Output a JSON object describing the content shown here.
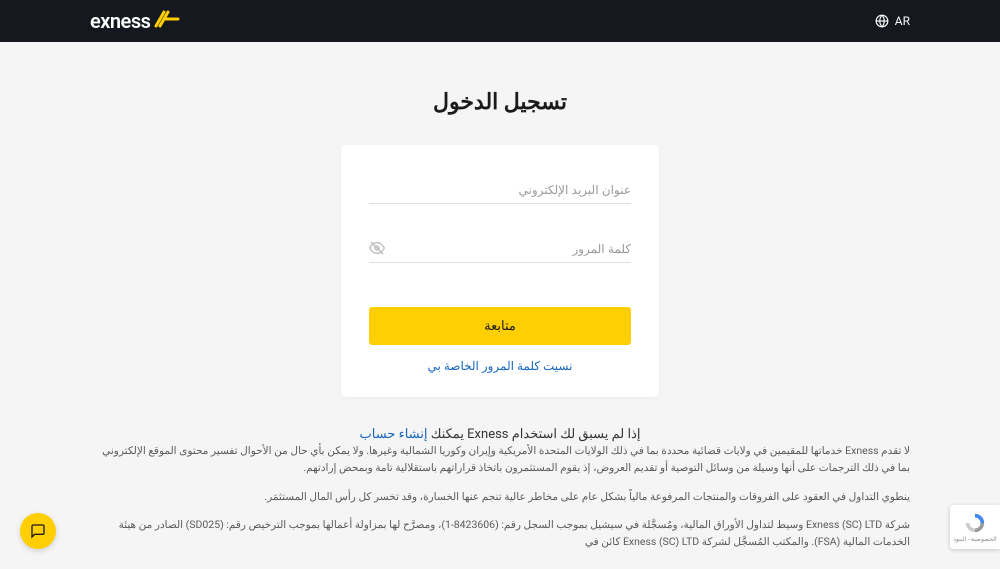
{
  "header": {
    "lang_label": "AR",
    "brand": "exness"
  },
  "login": {
    "title": "تسجيل الدخول",
    "email_placeholder": "عنوان البريد الإلكتروني",
    "password_placeholder": "كلمة المرور",
    "continue_label": "متابعة",
    "forgot_label": "نسيت كلمة المرور الخاصة بي"
  },
  "signup": {
    "text_prefix": "إذا لم يسبق لك استخدام Exness يمكنك ",
    "link_label": "إنشاء حساب"
  },
  "disclaimers": {
    "p1": "لا تقدم Exness خدماتها للمقيمين في ولايات قضائية محددة بما في ذلك الولايات المتحدة الأمريكية وإيران وكوريا الشمالية وغيرها. ولا يمكن بأي حال من الأحوال تفسير محتوى الموقع الإلكتروني بما في ذلك الترجمات على أنها وسيلة من وسائل التوصية أو تقديم العروض، إذ يقوم المستثمرون باتخاذ قراراتهم باستقلالية تامة وبمحض إرادتهم.",
    "p2": "ينطوي التداول في العقود على الفروقات والمنتجات المرفوعة مالياً بشكل عام على مخاطر عالية تنجم عنها الخسارة، وقد تخسر كل رأس المال المستثمَر.",
    "p3": "شركة Exness (SC) LTD وسيط لتداول الأوراق المالية، ومُسجَّلة في سيشيل بموجب السجل رقم: (8423606-1)، ومصرَّح لها بمزاولة أعمالها بموجب الترخيص رقم: (SD025) الصادر من هيئة الخدمات المالية (FSA). والمكتب المُسجَّل لشركة Exness (SC) LTD كائن في"
  },
  "recaptcha": {
    "label": "الخصوصية - البنود"
  },
  "colors": {
    "accent": "#ffcf01",
    "header_bg": "#15181f",
    "link": "#1565c0"
  }
}
